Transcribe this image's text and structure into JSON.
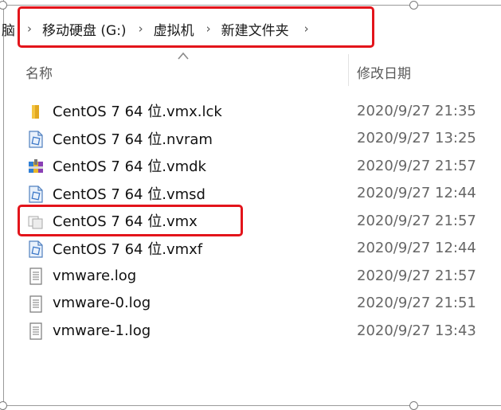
{
  "breadcrumb": {
    "truncated_prefix": "脑",
    "items": [
      "移动硬盘 (G:)",
      "虚拟机",
      "新建文件夹"
    ]
  },
  "columns": {
    "name": "名称",
    "date_modified": "修改日期"
  },
  "files": [
    {
      "name": "CentOS 7 64 位.vmx.lck",
      "date": "2020/9/27 21:35",
      "icon": "folder-icon"
    },
    {
      "name": "CentOS 7 64 位.nvram",
      "date": "2020/9/27 13:25",
      "icon": "vmware-file-icon"
    },
    {
      "name": "CentOS 7 64 位.vmdk",
      "date": "2020/9/27 21:57",
      "icon": "archive-icon"
    },
    {
      "name": "CentOS 7 64 位.vmsd",
      "date": "2020/9/27 12:44",
      "icon": "vmware-file-icon"
    },
    {
      "name": "CentOS 7 64 位.vmx",
      "date": "2020/9/27 21:57",
      "icon": "vmx-file-icon"
    },
    {
      "name": "CentOS 7 64 位.vmxf",
      "date": "2020/9/27 12:44",
      "icon": "vmware-file-icon"
    },
    {
      "name": "vmware.log",
      "date": "2020/9/27 21:57",
      "icon": "text-file-icon"
    },
    {
      "name": "vmware-0.log",
      "date": "2020/9/27 21:51",
      "icon": "text-file-icon"
    },
    {
      "name": "vmware-1.log",
      "date": "2020/9/27 13:43",
      "icon": "text-file-icon"
    }
  ],
  "colors": {
    "highlight": "#e3141b"
  }
}
